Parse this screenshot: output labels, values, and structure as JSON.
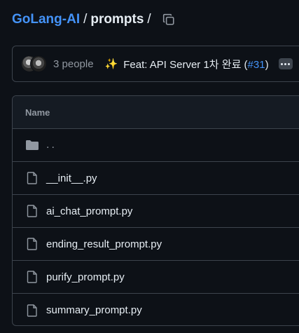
{
  "breadcrumb": {
    "repo": "GoLang-AI",
    "separator": "/",
    "directory": "prompts",
    "trailing_separator": "/"
  },
  "commit": {
    "people": "3 people",
    "sparkle": "✨",
    "message_prefix": "Feat: API Server 1차 완료 (",
    "pr_number": "#31",
    "message_suffix": ")"
  },
  "table": {
    "header": "Name",
    "parent": "..",
    "files": [
      {
        "name": "__init__.py"
      },
      {
        "name": "ai_chat_prompt.py"
      },
      {
        "name": "ending_result_prompt.py"
      },
      {
        "name": "purify_prompt.py"
      },
      {
        "name": "summary_prompt.py"
      }
    ]
  },
  "colors": {
    "background": "#0d1117",
    "link": "#4493f8",
    "border": "#3d444d",
    "text": "#e6edf3",
    "muted": "#9198a1"
  },
  "icons": {
    "copy": "copy-icon",
    "folder": "folder-icon",
    "file": "file-icon",
    "more": "kebab-menu-icon"
  }
}
